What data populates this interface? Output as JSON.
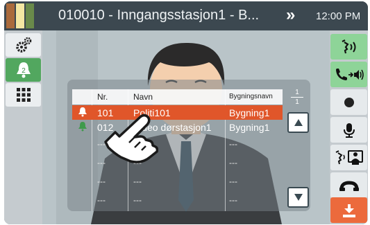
{
  "header": {
    "title": "010010 - Inngangsstasjon1 - B...",
    "more_symbol": "»",
    "clock": "12:00 PM"
  },
  "left_sidebar": {
    "items": [
      {
        "icon": "gear-icon",
        "active": false
      },
      {
        "icon": "bell-icon",
        "badge": "2",
        "active": true
      },
      {
        "icon": "keypad-icon",
        "active": false
      }
    ]
  },
  "right_sidebar": {
    "items": [
      {
        "icon": "talk-icon"
      },
      {
        "icon": "call-transfer-speaker-icon"
      },
      {
        "icon": "record-icon"
      },
      {
        "icon": "microphone-icon"
      },
      {
        "icon": "monitor-talk-icon"
      },
      {
        "icon": "hold-icon"
      },
      {
        "icon": "hang-up-icon"
      }
    ]
  },
  "station_list": {
    "columns": {
      "nr": "Nr.",
      "name": "Navn",
      "building": "Bygningsnavn"
    },
    "page": {
      "current": "1",
      "total": "1"
    },
    "rows": [
      {
        "nr": "101",
        "name": "Politi101",
        "building": "Bygning1",
        "icon": "bell-icon",
        "selected": true
      },
      {
        "nr": "012",
        "name": "Video dørstasjon1",
        "building": "Bygning1",
        "icon": "bell-icon",
        "selected": false
      },
      {
        "nr": "---",
        "name": "---",
        "building": "---",
        "icon": "",
        "selected": false
      },
      {
        "nr": "---",
        "name": "---",
        "building": "---",
        "icon": "",
        "selected": false
      },
      {
        "nr": "---",
        "name": "---",
        "building": "---",
        "icon": "",
        "selected": false
      },
      {
        "nr": "---",
        "name": "---",
        "building": "---",
        "icon": "",
        "selected": false
      }
    ]
  },
  "colors": {
    "accent_green": "#52a75f",
    "selection_orange": "#e0562a",
    "hangup_orange": "#ec6a3c",
    "topbar": "#3c4850"
  }
}
